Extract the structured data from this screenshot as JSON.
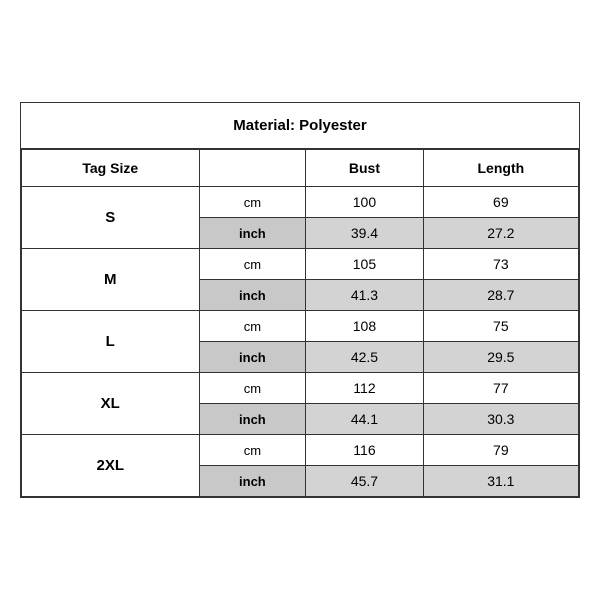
{
  "title": "Material: Polyester",
  "columns": {
    "tag_size": "Tag Size",
    "unit": "",
    "bust": "Bust",
    "length": "Length"
  },
  "rows": [
    {
      "size": "S",
      "cm": {
        "bust": "100",
        "length": "69"
      },
      "inch": {
        "bust": "39.4",
        "length": "27.2"
      }
    },
    {
      "size": "M",
      "cm": {
        "bust": "105",
        "length": "73"
      },
      "inch": {
        "bust": "41.3",
        "length": "28.7"
      }
    },
    {
      "size": "L",
      "cm": {
        "bust": "108",
        "length": "75"
      },
      "inch": {
        "bust": "42.5",
        "length": "29.5"
      }
    },
    {
      "size": "XL",
      "cm": {
        "bust": "112",
        "length": "77"
      },
      "inch": {
        "bust": "44.1",
        "length": "30.3"
      }
    },
    {
      "size": "2XL",
      "cm": {
        "bust": "116",
        "length": "79"
      },
      "inch": {
        "bust": "45.7",
        "length": "31.1"
      }
    }
  ],
  "unit_labels": {
    "cm": "cm",
    "inch": "inch"
  }
}
